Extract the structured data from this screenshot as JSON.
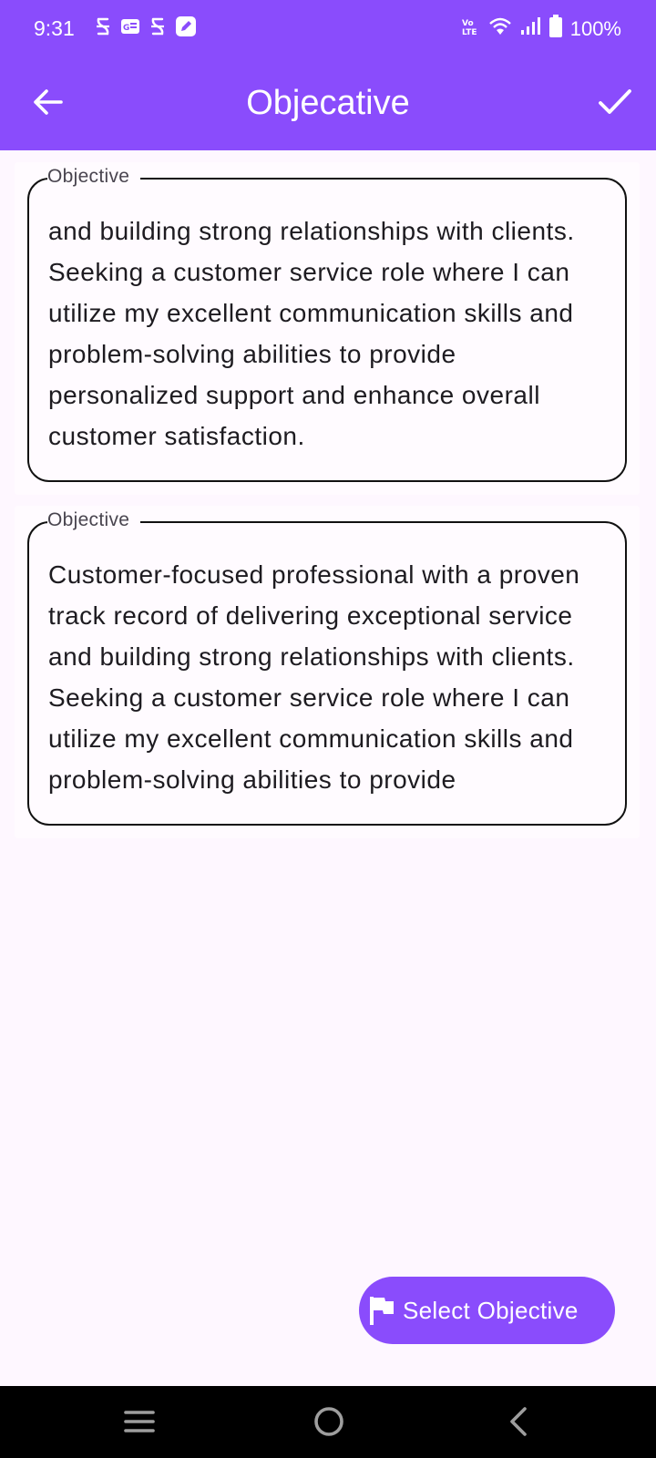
{
  "status_bar": {
    "time": "9:31",
    "battery_text": "100%",
    "left_icons": [
      "sim-icon",
      "id-card-icon",
      "sim-icon",
      "edit-app-icon"
    ],
    "right_icons": [
      "volte-icon",
      "wifi-icon",
      "signal-icon",
      "battery-icon"
    ]
  },
  "app_bar": {
    "title": "Objecative",
    "back_icon": "arrow-left-icon",
    "confirm_icon": "check-icon"
  },
  "objectives": [
    {
      "label": "Objective",
      "text": "Customer-focused professional with a proven track record of delivering exceptional service and building strong relationships with clients. Seeking a customer service role where I can utilize my excellent communication skills and problem-solving abilities to provide personalized support and enhance overall customer satisfaction."
    },
    {
      "label": "Objective",
      "text": "Customer-focused professional with a proven track record of delivering exceptional service and building strong relationships with clients. Seeking a customer service role where I can utilize my excellent communication skills and problem-solving abilities to provide personalized support and enhance overall customer satisfaction."
    }
  ],
  "fab": {
    "label": "Select Objective",
    "icon": "flag-icon"
  },
  "nav_bar": {
    "icons": [
      "menu-icon",
      "home-icon",
      "back-icon"
    ]
  },
  "colors": {
    "primary": "#8A4CFC",
    "background": "#FEF7FF",
    "nav_background": "#000000"
  }
}
